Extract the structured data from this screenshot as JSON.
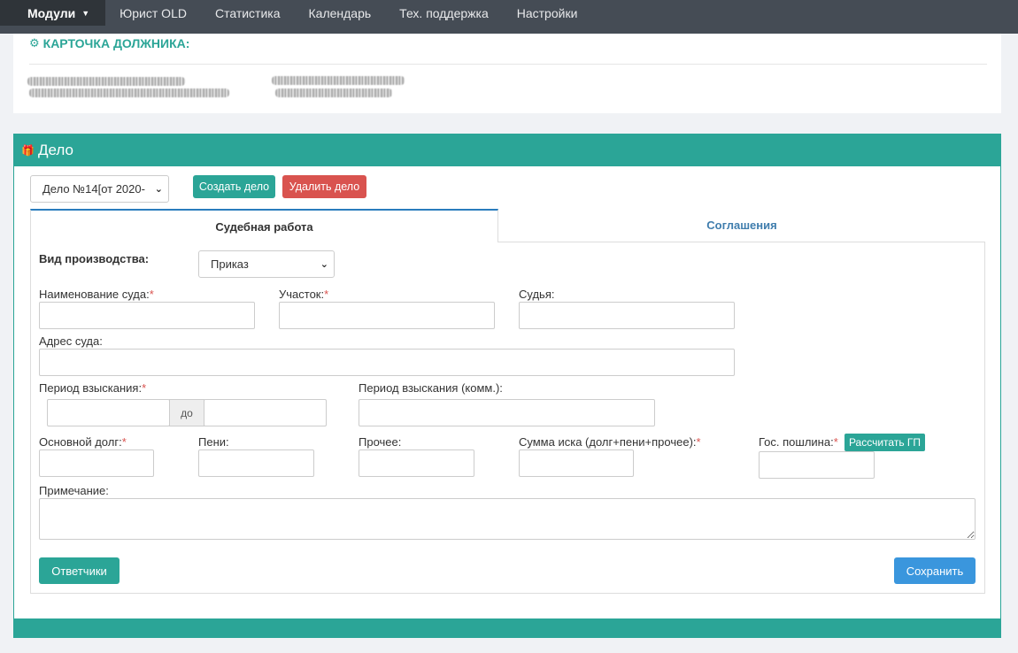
{
  "nav": {
    "items": [
      {
        "label": "Модули",
        "active": true
      },
      {
        "label": "Юрист OLD"
      },
      {
        "label": "Статистика"
      },
      {
        "label": "Календарь"
      },
      {
        "label": "Тех. поддержка"
      },
      {
        "label": "Настройки"
      }
    ],
    "caret": "⌄"
  },
  "debtor": {
    "title": "КАРТОЧКА ДОЛЖНИКА:",
    "icon": "gears-icon"
  },
  "case": {
    "header_title": "Дело",
    "icon": "gift-icon",
    "case_select_value": "Дело №14[от 2020-",
    "create_label": "Создать дело",
    "delete_label": "Удалить дело",
    "colors": {
      "accent": "#2ba597",
      "danger": "#d9534f",
      "primary": "#3a96dd"
    }
  },
  "tabs": [
    {
      "label": "Судебная работа",
      "active": true
    },
    {
      "label": "Соглашения",
      "active": false
    }
  ],
  "form": {
    "proceeding_label": "Вид производства:",
    "proceeding_value": "Приказ",
    "court_name_label": "Наименование суда:",
    "district_label": "Участок:",
    "judge_label": "Судья:",
    "court_address_label": "Адрес суда:",
    "period_label": "Период взыскания:",
    "period_to": "до",
    "period_comment_label": "Период взыскания (комм.):",
    "main_debt_label": "Основной долг:",
    "penalty_label": "Пени:",
    "other_label": "Прочее:",
    "claim_sum_label": "Сумма иска (долг+пени+прочее):",
    "state_fee_label": "Гос. пошлина:",
    "calc_fee_label": "Рассчитать ГП",
    "note_label": "Примечание:",
    "required_mark": "*"
  },
  "actions": {
    "defendants_label": "Ответчики",
    "save_label": "Сохранить"
  }
}
